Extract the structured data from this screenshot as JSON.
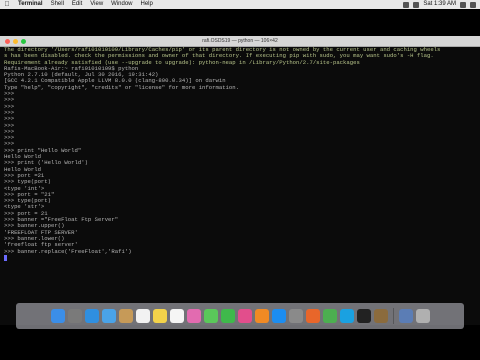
{
  "menubar": {
    "app_name": "Terminal",
    "items": [
      "Shell",
      "Edit",
      "View",
      "Window",
      "Help"
    ],
    "clock": "Sat 1:39 AM"
  },
  "window": {
    "title": "rafi.OSDS19 — python — 106×42"
  },
  "terminal": {
    "lines": [
      {
        "text": "The directory '/Users/rafi01010109/Library/Caches/pip' or its parent directory is not owned by the current user and caching wheels",
        "type": "warn"
      },
      {
        "text": "s has been disabled. check the permissions and owner of that directory. If executing pip with sudo, you may want sudo's -H flag.",
        "type": "warn"
      },
      {
        "text": "Requirement already satisfied (use --upgrade to upgrade): python-neap in /Library/Python/2.7/site-packages",
        "type": "warn"
      },
      {
        "text": "Rafis-MacBook-Air:~ rafi01010109$ python",
        "type": "normal"
      },
      {
        "text": "Python 2.7.10 (default, Jul 30 2016, 19:31:42)",
        "type": "normal"
      },
      {
        "text": "[GCC 4.2.1 Compatible Apple LLVM 8.0.0 (clang-800.0.34)] on darwin",
        "type": "normal"
      },
      {
        "text": "Type \"help\", \"copyright\", \"credits\" or \"license\" for more information.",
        "type": "normal"
      },
      {
        "text": ">>>",
        "type": "normal"
      },
      {
        "text": ">>>",
        "type": "normal"
      },
      {
        "text": ">>>",
        "type": "normal"
      },
      {
        "text": ">>>",
        "type": "normal"
      },
      {
        "text": ">>>",
        "type": "normal"
      },
      {
        "text": ">>>",
        "type": "normal"
      },
      {
        "text": ">>>",
        "type": "normal"
      },
      {
        "text": ">>>",
        "type": "normal"
      },
      {
        "text": ">>>",
        "type": "normal"
      },
      {
        "text": ">>> print \"Hello World\"",
        "type": "normal"
      },
      {
        "text": "Hello World",
        "type": "normal"
      },
      {
        "text": ">>> print ('Hello World')",
        "type": "normal"
      },
      {
        "text": "Hello World",
        "type": "normal"
      },
      {
        "text": ">>> port =21",
        "type": "normal"
      },
      {
        "text": ">>> type(port)",
        "type": "normal"
      },
      {
        "text": "<type 'int'>",
        "type": "normal"
      },
      {
        "text": ">>> port = \"21\"",
        "type": "normal"
      },
      {
        "text": ">>> type(port)",
        "type": "normal"
      },
      {
        "text": "<type 'str'>",
        "type": "normal"
      },
      {
        "text": ">>> port = 21",
        "type": "normal"
      },
      {
        "text": ">>> banner =\"FreeFloat Ftp Server\"",
        "type": "normal"
      },
      {
        "text": ">>> banner.upper()",
        "type": "normal"
      },
      {
        "text": "'FREEFLOAT FTP SERVER'",
        "type": "normal"
      },
      {
        "text": ">>> banner.lower()",
        "type": "normal"
      },
      {
        "text": "'freefloat ftp server'",
        "type": "normal"
      },
      {
        "text": ">>> banner.replace('FreeFloat','Rafi')",
        "type": "normal"
      }
    ]
  },
  "dock": {
    "apps": [
      {
        "name": "Finder",
        "icon": "finder-icon",
        "color": "#3b8ee8"
      },
      {
        "name": "Launchpad",
        "icon": "launchpad-icon",
        "color": "#7a7a7a"
      },
      {
        "name": "Safari",
        "icon": "safari-icon",
        "color": "#2f8fe0"
      },
      {
        "name": "Mail",
        "icon": "mail-icon",
        "color": "#4aa3e8"
      },
      {
        "name": "Contacts",
        "icon": "contacts-icon",
        "color": "#c69a58"
      },
      {
        "name": "Calendar",
        "icon": "calendar-icon",
        "color": "#f2f2f2"
      },
      {
        "name": "Notes",
        "icon": "notes-icon",
        "color": "#f3d34a"
      },
      {
        "name": "Reminders",
        "icon": "reminders-icon",
        "color": "#f5f5f5"
      },
      {
        "name": "Photos",
        "icon": "photos-icon",
        "color": "#e26bb0"
      },
      {
        "name": "Messages",
        "icon": "messages-icon",
        "color": "#5ac85a"
      },
      {
        "name": "FaceTime",
        "icon": "facetime-icon",
        "color": "#3fb94b"
      },
      {
        "name": "iTunes",
        "icon": "itunes-icon",
        "color": "#e24e8c"
      },
      {
        "name": "iBooks",
        "icon": "ibooks-icon",
        "color": "#f08a24"
      },
      {
        "name": "App Store",
        "icon": "appstore-icon",
        "color": "#1c8df0"
      },
      {
        "name": "System Preferences",
        "icon": "preferences-icon",
        "color": "#8a8a8a"
      },
      {
        "name": "Firefox",
        "icon": "firefox-icon",
        "color": "#e8662a"
      },
      {
        "name": "Chrome",
        "icon": "chrome-icon",
        "color": "#4caf50"
      },
      {
        "name": "Skype",
        "icon": "skype-icon",
        "color": "#1aa1e1"
      },
      {
        "name": "Terminal",
        "icon": "terminal-icon",
        "color": "#222222"
      },
      {
        "name": "Preview",
        "icon": "preview-icon",
        "color": "#8b6b3d"
      },
      {
        "name": "Downloads",
        "icon": "downloads-icon",
        "color": "#5b7db5"
      },
      {
        "name": "Trash",
        "icon": "trash-icon",
        "color": "#b0b0b0"
      }
    ]
  }
}
